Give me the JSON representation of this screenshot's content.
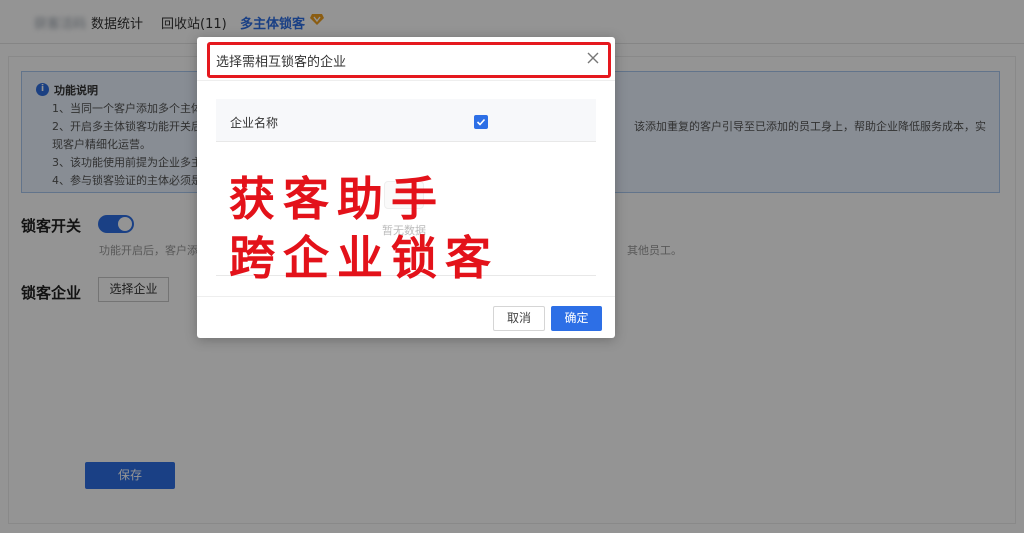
{
  "tabs": [
    {
      "label": "获客活码"
    },
    {
      "label": "数据统计"
    },
    {
      "label": "回收站(11)"
    },
    {
      "label": "多主体锁客"
    }
  ],
  "info": {
    "icon": "info-icon",
    "title": "功能说明",
    "lines": [
      "1、当同一个客户添加多个主体",
      "2、开启多主体锁客功能开关后",
      "现客户精细化运营。",
      "3、该功能使用前提为企业多主",
      "4、参与锁客验证的主体必须是"
    ],
    "line2_tail": "该添加重复的客户引导至已添加的员工身上，帮助企业降低服务成本，实"
  },
  "lock_switch": {
    "label": "锁客开关",
    "on": true,
    "hint": "功能开启后，客户添",
    "hint_tail": "其他员工。"
  },
  "lock_company": {
    "label": "锁客企业",
    "select_button": "选择企业"
  },
  "save_button": "保存",
  "modal": {
    "title": "选择需相互锁客的企业",
    "close_icon": "close-icon",
    "table": {
      "column_name": "企业名称",
      "header_checked": true,
      "empty_text": "暂无数据"
    },
    "cancel": "取消",
    "confirm": "确定"
  },
  "watermark": {
    "line1": "获客助手",
    "line2": "跨企业锁客"
  },
  "colors": {
    "accent": "#2d6fe6",
    "highlight": "#e5181e",
    "watermark": "#e3121a",
    "info_bg": "#eaf3ff"
  }
}
